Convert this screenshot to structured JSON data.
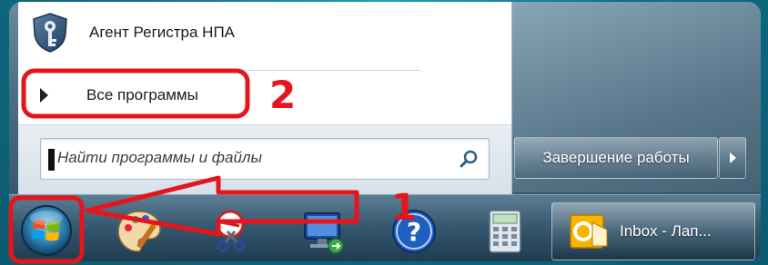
{
  "start_menu": {
    "pinned_item_label": "Агент Регистра НПА",
    "all_programs_label": "Все программы",
    "search_placeholder": "Найти программы и файлы",
    "shutdown_label": "Завершение работы"
  },
  "taskbar": {
    "outlook_label": "Inbox - Лап..."
  },
  "annotations": {
    "step1": "1",
    "step2": "2"
  },
  "colors": {
    "annotation_red": "#e8141c",
    "taskbar_dark": "#1f3b50"
  },
  "icons": {
    "agent": "shield-key-icon",
    "search": "search-icon",
    "start": "windows-orb-icon",
    "paint": "paint-palette-icon",
    "snipping": "snipping-tool-icon",
    "remote": "remote-desktop-icon",
    "help": "help-icon",
    "calculator": "calculator-icon",
    "outlook": "outlook-icon"
  }
}
